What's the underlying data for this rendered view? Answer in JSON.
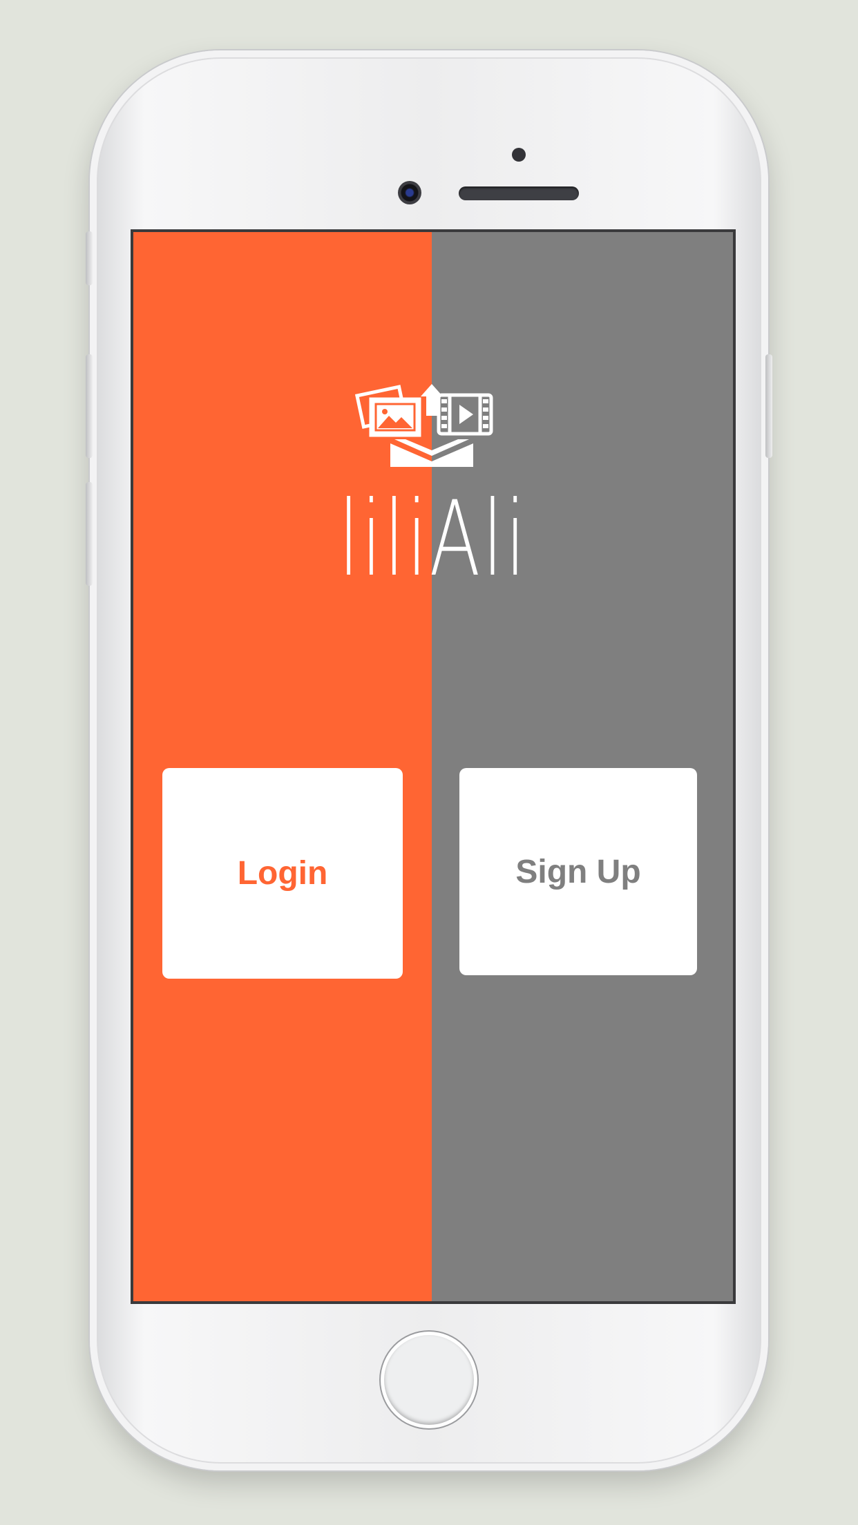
{
  "app": {
    "name": "liliAli",
    "left_color": "#ff6533",
    "right_color": "#7f7f7f"
  },
  "logo": {
    "text": "liliAli",
    "icon": "media-upload-icon"
  },
  "buttons": {
    "login_label": "Login",
    "signup_label": "Sign Up"
  },
  "device": {
    "icons": [
      "front-camera-icon",
      "earpiece-speaker-icon",
      "home-button"
    ]
  }
}
